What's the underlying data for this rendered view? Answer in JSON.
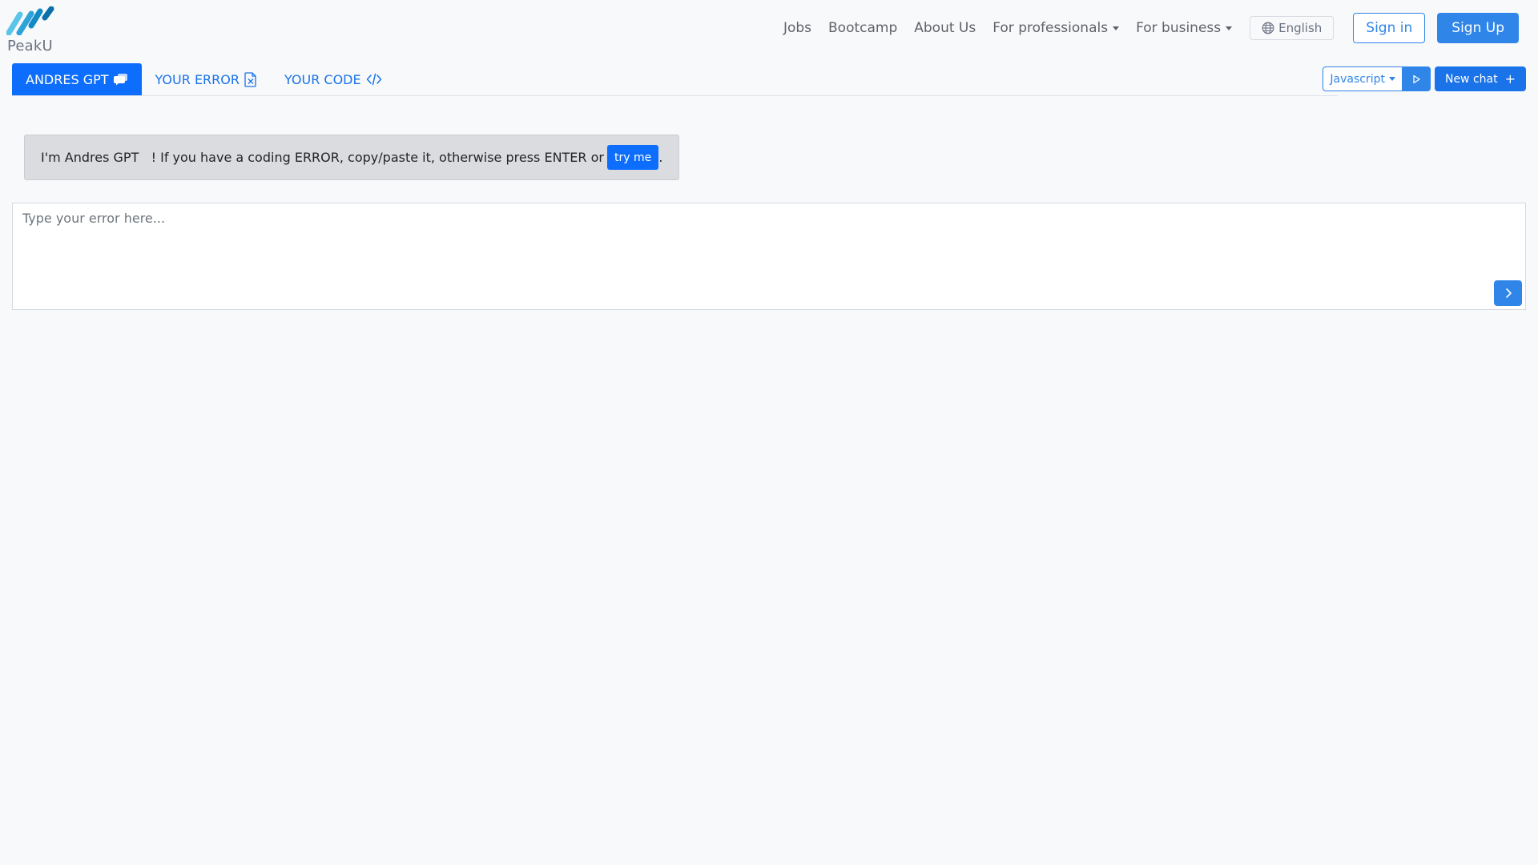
{
  "header": {
    "logo_text": "PeakU",
    "nav": {
      "jobs": "Jobs",
      "bootcamp": "Bootcamp",
      "about": "About Us",
      "for_professionals": "For professionals",
      "for_business": "For business"
    },
    "language": "English",
    "sign_in": "Sign in",
    "sign_up": "Sign Up"
  },
  "tabs": {
    "andres_gpt": "ANDRES GPT",
    "your_error": "YOUR ERROR",
    "your_code": "YOUR CODE"
  },
  "toolbar": {
    "language_select": "Javascript",
    "new_chat": "New chat"
  },
  "message": {
    "text": "I'm Andres GPT   ! If you have a coding ERROR, copy/paste it, otherwise press ENTER or",
    "try_me": "try me",
    "trailing": "."
  },
  "input": {
    "placeholder": "Type your error here..."
  },
  "colors": {
    "primary": "#0d6efd",
    "accent": "#2f86e8",
    "background": "#f8f9fb",
    "bubble": "#dadcdf"
  },
  "icons": {
    "logo": "peaku-logo-icon",
    "globe": "globe-icon",
    "chat": "chat-icon",
    "error_file": "file-x-icon",
    "code": "code-icon",
    "run": "play-icon",
    "plus": "plus-icon",
    "send": "chevron-right-icon"
  }
}
